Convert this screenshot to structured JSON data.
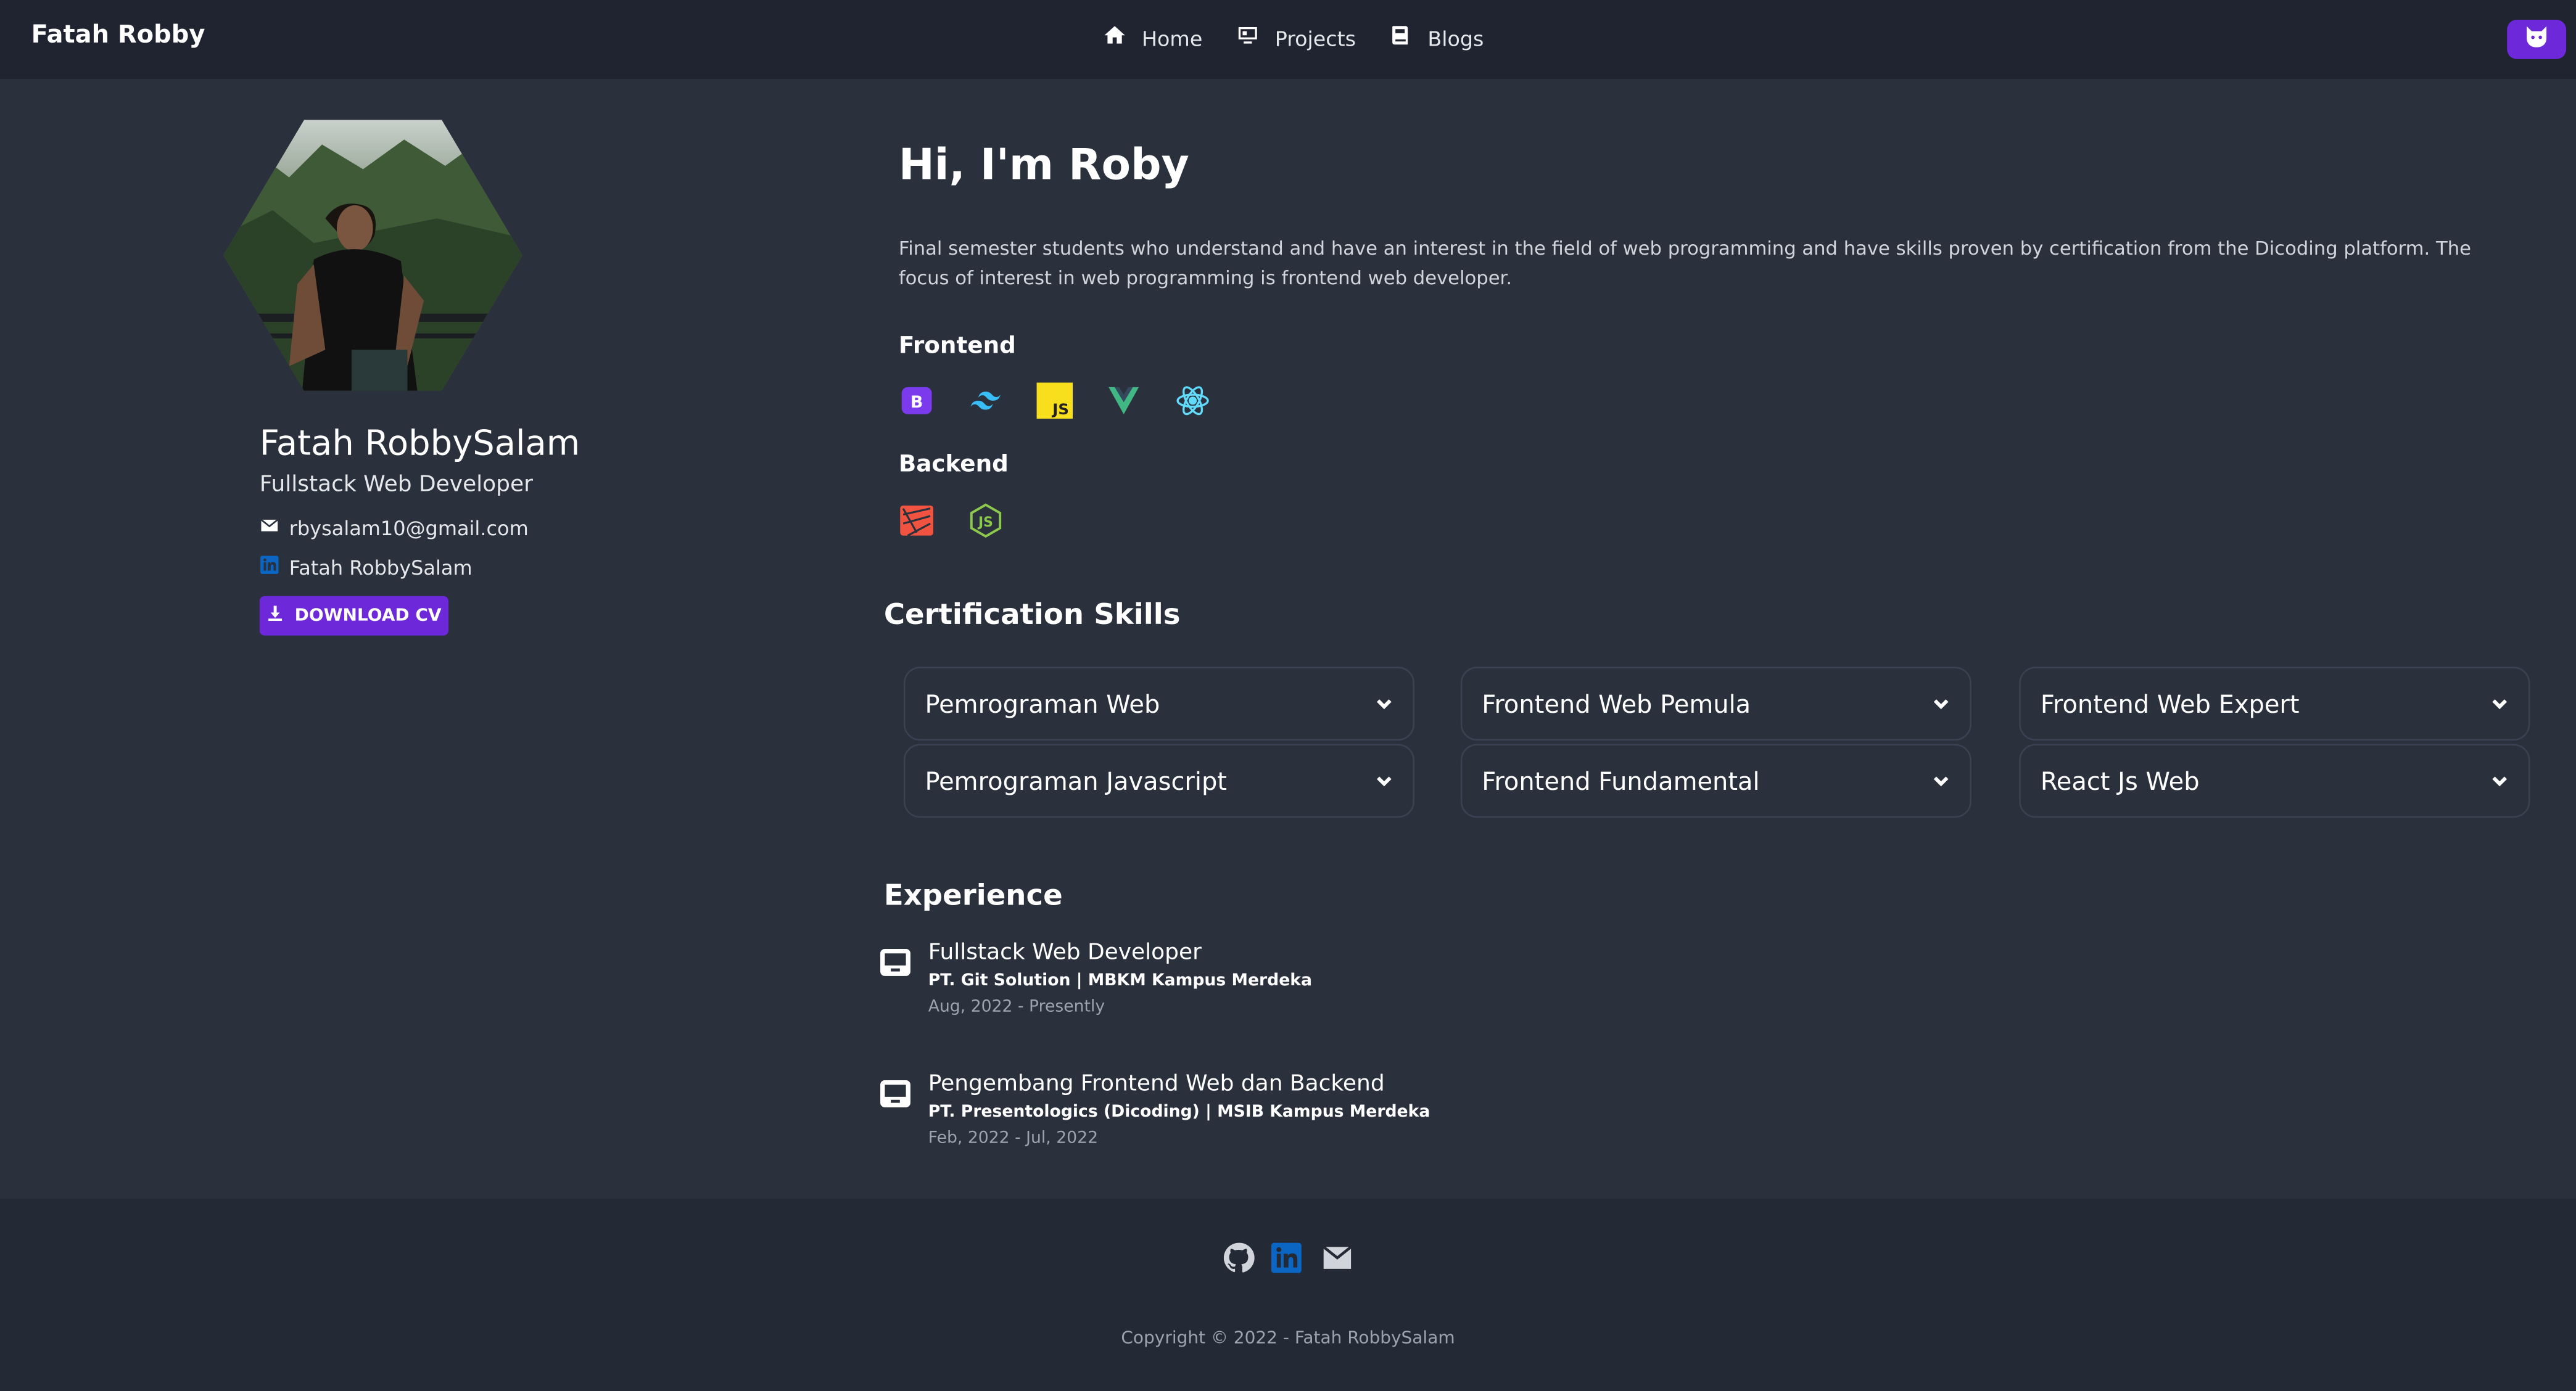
{
  "navbar": {
    "brand": "Fatah Robby",
    "links": [
      {
        "label": "Home",
        "icon": "home-icon"
      },
      {
        "label": "Projects",
        "icon": "projects-icon"
      },
      {
        "label": "Blogs",
        "icon": "blogs-icon"
      }
    ],
    "theme_toggle_icon": "cat-icon"
  },
  "profile": {
    "name": "Fatah RobbySalam",
    "role": "Fullstack Web Developer",
    "email": "rbysalam10@gmail.com",
    "linkedin": "Fatah RobbySalam",
    "download_label": "DOWNLOAD CV"
  },
  "hero": {
    "title": "Hi, I'm Roby",
    "description": "Final semester students who understand and have an interest in the field of web programming and have skills proven by certification from the Dicoding platform. The focus of interest in web programming is frontend web developer."
  },
  "skills": {
    "frontend_label": "Frontend",
    "frontend_icons": [
      "bootstrap-icon",
      "tailwind-icon",
      "javascript-icon",
      "vue-icon",
      "react-icon"
    ],
    "backend_label": "Backend",
    "backend_icons": [
      "laravel-icon",
      "nodejs-icon"
    ]
  },
  "certifications": {
    "title": "Certification Skills",
    "items": [
      "Pemrograman Web",
      "Frontend Web Pemula",
      "Frontend Web Expert",
      "Pemrograman Javascript",
      "Frontend Fundamental",
      "React Js Web"
    ]
  },
  "experience": {
    "title": "Experience",
    "items": [
      {
        "title": "Fullstack Web Developer",
        "company": "PT. Git Solution | MBKM Kampus Merdeka",
        "date": "Aug, 2022 - Presently"
      },
      {
        "title": "Pengembang Frontend Web dan Backend",
        "company": "PT. Presentologics (Dicoding) | MSIB Kampus Merdeka",
        "date": "Feb, 2022 - Jul, 2022"
      }
    ]
  },
  "footer": {
    "icons": [
      "github-icon",
      "linkedin-icon",
      "mail-icon"
    ],
    "copyright": "Copyright © 2022 - Fatah RobbySalam"
  },
  "colors": {
    "background": "#2a303c",
    "navbar": "#1f2430",
    "accent": "#6d28d9",
    "footer": "#232935"
  }
}
